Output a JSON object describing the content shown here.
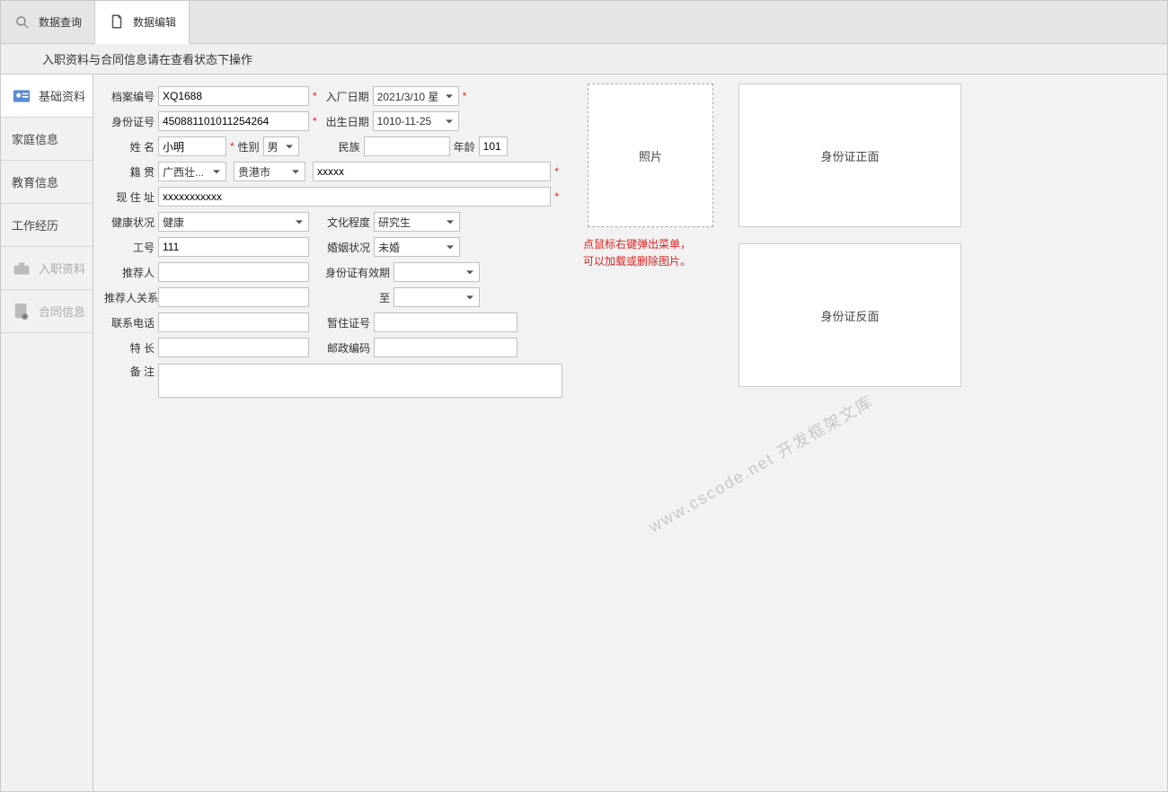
{
  "tabs": {
    "query": "数据查询",
    "edit": "数据编辑"
  },
  "banner": "入职资料与合同信息请在查看状态下操作",
  "sidenav": {
    "basic": "基础资料",
    "family": "家庭信息",
    "education": "教育信息",
    "work": "工作经历",
    "onboard": "入职资料",
    "contract": "合同信息"
  },
  "form": {
    "archive_no_label": "档案编号",
    "archive_no": "XQ1688",
    "entry_date_label": "入厂日期",
    "entry_date": "2021/3/10 星",
    "id_no_label": "身份证号",
    "id_no": "450881101011254264",
    "birth_date_label": "出生日期",
    "birth_date": "1010-11-25",
    "name_label": "姓      名",
    "name": "小明",
    "gender_label": "性别",
    "gender": "男",
    "ethnic_label": "民族",
    "ethnic": "",
    "age_label": "年龄",
    "age": "101",
    "origin_label": "籍      贯",
    "origin_province": "广西壮...",
    "origin_city": "贵港市",
    "origin_detail": "xxxxx",
    "addr_label": "现 住 址",
    "addr": "xxxxxxxxxxx",
    "health_label": "健康状况",
    "health": "健康",
    "edu_label": "文化程度",
    "edu": "研究生",
    "emp_no_label": "工号",
    "emp_no": "111",
    "marriage_label": "婚姻状况",
    "marriage": "未婚",
    "referrer_label": "推荐人",
    "referrer": "",
    "id_valid_label": "身份证有效期",
    "id_valid_from": "",
    "referrer_rel_label": "推荐人关系",
    "referrer_rel": "",
    "id_valid_to_label": "至",
    "id_valid_to": "",
    "phone_label": "联系电话",
    "phone": "",
    "permit_label": "暂住证号",
    "permit": "",
    "specialty_label": "特      长",
    "specialty": "",
    "postal_label": "邮政编码",
    "postal": "",
    "remark_label": "备      注",
    "remark": ""
  },
  "photos": {
    "portrait": "照片",
    "id_front": "身份证正面",
    "id_back": "身份证反面",
    "hint_line1": "点鼠标右键弹出菜单，",
    "hint_line2": "可以加载或删除图片。"
  },
  "watermark": "www.cscode.net 开发框架文库"
}
